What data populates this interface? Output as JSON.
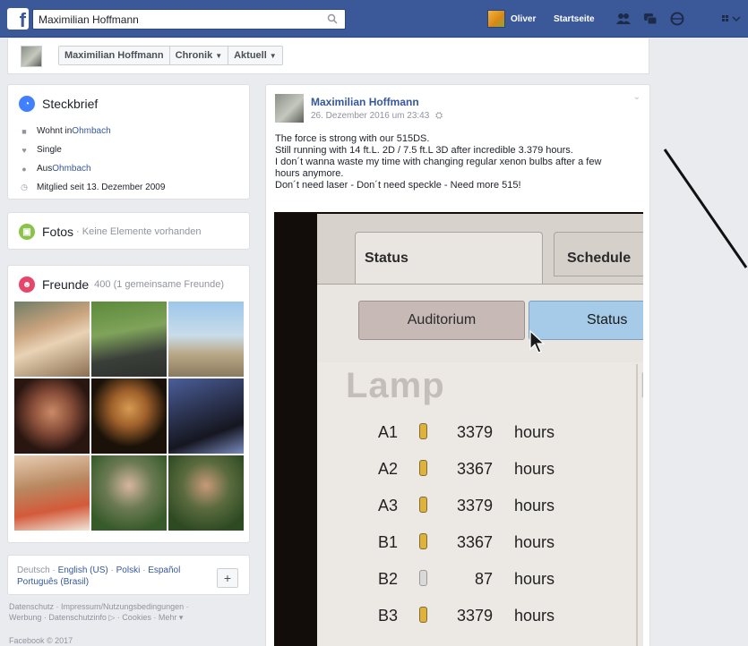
{
  "topbar": {
    "search_value": "Maximilian Hoffmann",
    "user_name": "Oliver",
    "home_label": "Startseite"
  },
  "profile_strip": {
    "name_button": "Maximilian Hoffmann",
    "timeline_button": "Chronik",
    "recent_button": "Aktuell"
  },
  "intro": {
    "title": "Steckbrief",
    "items": [
      {
        "prefix": "Wohnt in ",
        "link": "Ohmbach",
        "icon": "home-icon"
      },
      {
        "prefix": "Single",
        "link": "",
        "icon": "heart-icon"
      },
      {
        "prefix": "Aus ",
        "link": "Ohmbach",
        "icon": "location-pin-icon"
      },
      {
        "prefix": "Mitglied seit 13. Dezember 2009",
        "link": "",
        "icon": "clock-icon"
      }
    ]
  },
  "photos": {
    "title": "Fotos",
    "subtitle": "· Keine Elemente vorhanden"
  },
  "friends": {
    "title": "Freunde",
    "subtitle": "400 (1 gemeinsame Freunde)"
  },
  "languages": {
    "line1": [
      "Deutsch",
      "English (US)",
      "Polski",
      "Español"
    ],
    "line2": "Português (Brasil)"
  },
  "footer": {
    "line1": "Datenschutz · Impressum/Nutzungsbedingungen ·",
    "line2": "Werbung · Datenschutzinfo ▷ · Cookies · Mehr ▾",
    "copyright": "Facebook © 2017"
  },
  "post": {
    "author": "Maximilian Hoffmann",
    "timestamp": "26. Dezember 2016 um 23:43",
    "text_lines": [
      "The force is strong with our 515DS.",
      "Still running with 14 ft.L. 2D / 7.5 ft.L 3D after incredible 3.379 hours.",
      "I don´t wanna waste my time with changing regular xenon bulbs after a few",
      "hours anymore.",
      "Don´t need laser - Don´t need speckle - Need more 515!"
    ]
  },
  "photo_screen": {
    "tab_status": "Status",
    "tab_schedule": "Schedule",
    "btn_auditorium": "Auditorium",
    "btn_status": "Status",
    "heading": "Lamp",
    "heading_partial": "P",
    "unit": "hours",
    "lamps": [
      {
        "id": "A1",
        "hours": "3379",
        "active": true
      },
      {
        "id": "A2",
        "hours": "3367",
        "active": true
      },
      {
        "id": "A3",
        "hours": "3379",
        "active": true
      },
      {
        "id": "B1",
        "hours": "3367",
        "active": true
      },
      {
        "id": "B2",
        "hours": "87",
        "active": false
      },
      {
        "id": "B3",
        "hours": "3379",
        "active": true
      }
    ]
  },
  "colors": {
    "brand": "#3b5998",
    "link": "#365899",
    "intro_icon": "#4080ff",
    "photos_icon": "#8bc34a",
    "friends_icon": "#e8456b",
    "lamp_on": "#e0b23a",
    "lamp_off": "#d9d9d9"
  }
}
